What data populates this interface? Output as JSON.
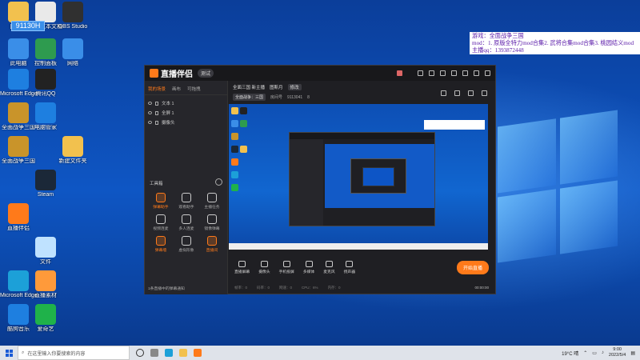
{
  "desktop": {
    "icons": [
      {
        "label": "回收站",
        "name": "recycle-bin-icon",
        "color": "#f2c14e"
      },
      {
        "label": "新建文本文档",
        "name": "text-document-icon",
        "color": "#e9e9e9"
      },
      {
        "label": "OBS Studio",
        "name": "obs-icon",
        "color": "#303030"
      },
      {
        "label": "此电脑",
        "name": "this-pc-icon",
        "color": "#3a8ee8"
      },
      {
        "label": "控制面板",
        "name": "control-panel-icon",
        "color": "#2e9b4f"
      },
      {
        "label": "网络",
        "name": "network-icon",
        "color": "#3a8ee8"
      },
      {
        "label": "Microsoft Edge",
        "name": "ie-icon",
        "color": "#1e7fe0"
      },
      {
        "label": "腾讯QQ",
        "name": "qq-icon",
        "color": "#222"
      },
      {
        "label": "全面战争三国",
        "name": "game-three-kingdoms-icon",
        "color": "#c9942a"
      },
      {
        "label": "电脑管家",
        "name": "pc-manager-icon",
        "color": "#1e7fe0"
      },
      {
        "label": "全面战争三国",
        "name": "game-tw-icon",
        "color": "#c9942a"
      },
      {
        "label": "新建文件夹",
        "name": "folder-icon",
        "color": "#f2c14e"
      },
      {
        "label": "Steam",
        "name": "steam-icon",
        "color": "#1b2838"
      },
      {
        "label": "直播伴侣",
        "name": "live-companion-icon",
        "color": "#ff7a1a"
      },
      {
        "label": "文件",
        "name": "file-icon",
        "color": "#bfe2ff"
      },
      {
        "label": "Microsoft Edge",
        "name": "edge-icon",
        "color": "#1ca0d8"
      },
      {
        "label": "直播素材",
        "name": "live-assets-icon",
        "color": "#ff9a3a"
      },
      {
        "label": "酷狗音乐",
        "name": "kugou-icon",
        "color": "#1e7fe0"
      },
      {
        "label": "爱奇艺",
        "name": "media-player-icon",
        "color": "#1fb24a"
      }
    ],
    "account_badge": "91130H"
  },
  "overlay_note": {
    "line1": "游戏：全面战争三国",
    "line2": "mod：1. 原版全特力mod合集2. 武将合集mod合集3. 桃园结义mod",
    "line3": "主播qq：1393872448"
  },
  "app": {
    "logo_text": "直播伴侣",
    "version_tag": "测试",
    "tabs": [
      "我的场景",
      "画布",
      "可拖拽"
    ],
    "scenes": [
      "文本 1",
      "全屏 1",
      "摄像头"
    ],
    "tool_header": "工具箱",
    "tools": [
      {
        "label": "弹幕助手",
        "orange": true
      },
      {
        "label": "观看助手",
        "orange": false
      },
      {
        "label": "主播任务",
        "orange": false
      },
      {
        "label": "视频连麦",
        "orange": false
      },
      {
        "label": "多人连麦",
        "orange": false
      },
      {
        "label": "镜像弹幕",
        "orange": false
      },
      {
        "label": "弹幕墙",
        "orange": true
      },
      {
        "label": "虚拟形象",
        "orange": false
      },
      {
        "label": "直播间",
        "orange": true
      }
    ],
    "left_footer": "1条直播中的弹幕通知",
    "room": {
      "title": "全面三国 新主播",
      "subtitle": "图斯月",
      "edit": "修改",
      "category": "全面战争：三国",
      "room_id": "房间号",
      "room_number": "9113041",
      "likes": "8"
    },
    "bottom_actions": [
      "直播屏幕",
      "摄像头",
      "手机投屏",
      "多媒体",
      "麦克风",
      "扬声器"
    ],
    "go_live": "开始直播",
    "status": [
      "帧率：0",
      "码率：0",
      "网速：0",
      "CPU：6%",
      "内存：0"
    ],
    "timer": "00:00:00"
  },
  "taskbar": {
    "search_placeholder": "在这里输入你要搜索的内容",
    "weather": "19°C 晴",
    "time": "9:00",
    "date": "2022/5/4"
  }
}
